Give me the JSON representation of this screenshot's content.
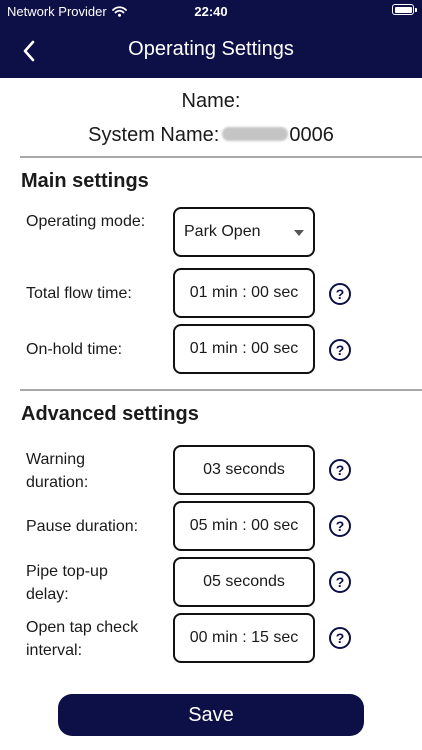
{
  "status_bar": {
    "carrier": "Network Provider",
    "time": "22:40",
    "wifi_icon": "wifi-icon",
    "battery_icon": "battery-icon"
  },
  "nav": {
    "back_icon": "chevron-left-icon",
    "title": "Operating Settings"
  },
  "system": {
    "name_label": "Name:",
    "name_value": "",
    "system_name_label": "System Name:",
    "system_name_suffix": "0006"
  },
  "main_settings": {
    "title": "Main settings",
    "operating_mode": {
      "label": "Operating mode:",
      "value": "Park Open"
    },
    "total_flow_time": {
      "label": "Total flow time:",
      "value": "01 min : 00 sec"
    },
    "on_hold_time": {
      "label": "On-hold time:",
      "value": "01 min : 00 sec"
    }
  },
  "advanced_settings": {
    "title": "Advanced settings",
    "warning_duration": {
      "label": "Warning duration:",
      "value": "03 seconds"
    },
    "pause_duration": {
      "label": "Pause duration:",
      "value": "05 min : 00 sec"
    },
    "pipe_topup_delay": {
      "label": "Pipe top-up delay:",
      "value": "05 seconds"
    },
    "open_tap_check_interval": {
      "label": "Open tap check interval:",
      "value": "00 min : 15 sec"
    }
  },
  "help_glyph": "?",
  "save_label": "Save",
  "colors": {
    "primary": "#0d1046",
    "divider": "#a9a9a9",
    "text": "#1a1a1a",
    "background": "#ffffff"
  }
}
